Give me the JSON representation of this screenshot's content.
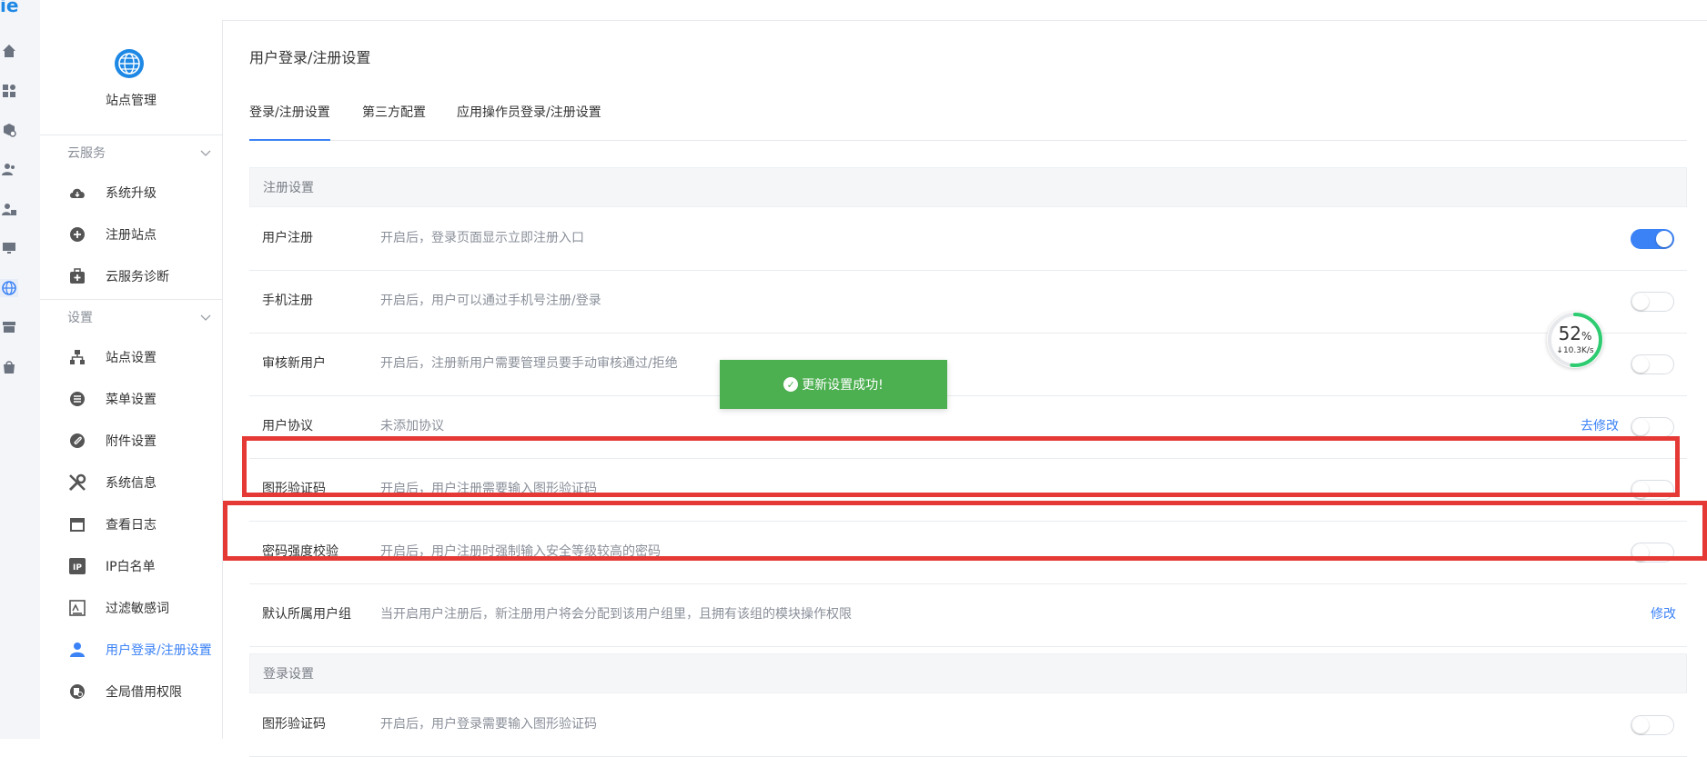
{
  "rail": {
    "logo": "ie",
    "active_color": "#3b82f6"
  },
  "sidebar": {
    "site_label": "站点管理",
    "groups": [
      {
        "title": "云服务",
        "items": [
          {
            "label": "系统升级",
            "icon": "cloud-download-icon"
          },
          {
            "label": "注册站点",
            "icon": "plus-circle-icon"
          },
          {
            "label": "云服务诊断",
            "icon": "medkit-icon"
          }
        ]
      },
      {
        "title": "设置",
        "items": [
          {
            "label": "站点设置",
            "icon": "sitemap-icon"
          },
          {
            "label": "菜单设置",
            "icon": "list-icon"
          },
          {
            "label": "附件设置",
            "icon": "paperclip-icon"
          },
          {
            "label": "系统信息",
            "icon": "tools-icon"
          },
          {
            "label": "查看日志",
            "icon": "calendar-icon"
          },
          {
            "label": "IP白名单",
            "icon": "ip-icon"
          },
          {
            "label": "过滤敏感词",
            "icon": "filter-icon"
          },
          {
            "label": "用户登录/注册设置",
            "icon": "user-icon",
            "active": true
          },
          {
            "label": "全局借用权限",
            "icon": "permission-icon"
          }
        ]
      }
    ]
  },
  "main": {
    "title": "用户登录/注册设置",
    "tabs": [
      {
        "label": "登录/注册设置",
        "active": true
      },
      {
        "label": "第三方配置"
      },
      {
        "label": "应用操作员登录/注册设置"
      }
    ],
    "register_section": {
      "title": "注册设置",
      "rows": [
        {
          "name": "用户注册",
          "desc": "开启后，登录页面显示立即注册入口",
          "toggle": true
        },
        {
          "name": "手机注册",
          "desc": "开启后，用户可以通过手机号注册/登录",
          "toggle": false
        },
        {
          "name": "审核新用户",
          "desc": "开启后，注册新用户需要管理员要手动审核通过/拒绝",
          "toggle": false
        },
        {
          "name": "用户协议",
          "desc": "未添加协议",
          "link": "去修改",
          "toggle": false
        },
        {
          "name": "图形验证码",
          "desc": "开启后，用户注册需要输入图形验证码",
          "toggle": false
        },
        {
          "name": "密码强度校验",
          "desc": "开启后，用户注册时强制输入安全等级较高的密码",
          "toggle": false
        },
        {
          "name": "默认所属用户组",
          "desc": "当开启用户注册后，新注册用户将会分配到该用户组里，且拥有该组的模块操作权限",
          "link": "修改"
        }
      ]
    },
    "login_section": {
      "title": "登录设置",
      "rows": [
        {
          "name": "图形验证码",
          "desc": "开启后，用户登录需要输入图形验证码",
          "toggle": false
        }
      ]
    }
  },
  "toast": {
    "text": "更新设置成功!",
    "color": "#4caf50"
  },
  "speed_widget": {
    "percent": "52",
    "percent_unit": "%",
    "rate": "10.3K/s",
    "progress": 0.52
  },
  "colors": {
    "accent": "#3b82f6",
    "highlight": "#e53935"
  }
}
